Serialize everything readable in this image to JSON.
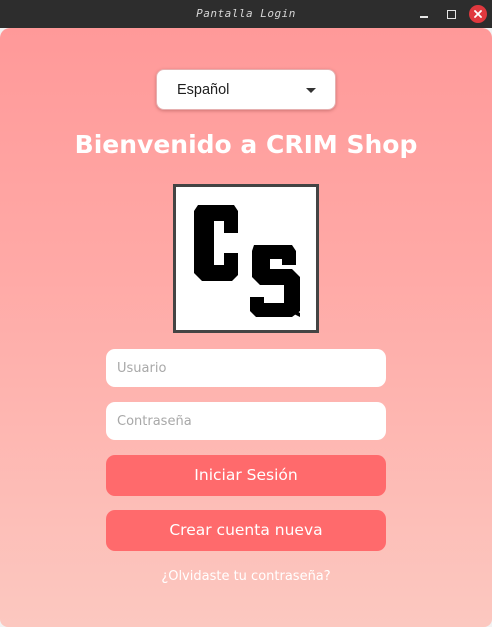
{
  "window": {
    "title": "Pantalla Login"
  },
  "language_select": {
    "selected": "Español"
  },
  "welcome_text": "Bienvenido a CRIM Shop",
  "logo": {
    "text": "CS"
  },
  "form": {
    "username_placeholder": "Usuario",
    "username_value": "",
    "password_placeholder": "Contraseña",
    "password_value": "",
    "login_label": "Iniciar Sesión",
    "create_label": "Crear cuenta nueva",
    "forgot_label": "¿Olvidaste tu contraseña?"
  },
  "colors": {
    "titlebar": "#2d2d2d",
    "gradient_top": "#ff9999",
    "gradient_bottom": "#fcc8c0",
    "button": "#ff6a6c",
    "close_button": "#e0383e"
  },
  "icons": {
    "minimize": "minimize-icon",
    "maximize": "maximize-icon",
    "close": "close-icon",
    "dropdown": "chevron-down-icon"
  }
}
